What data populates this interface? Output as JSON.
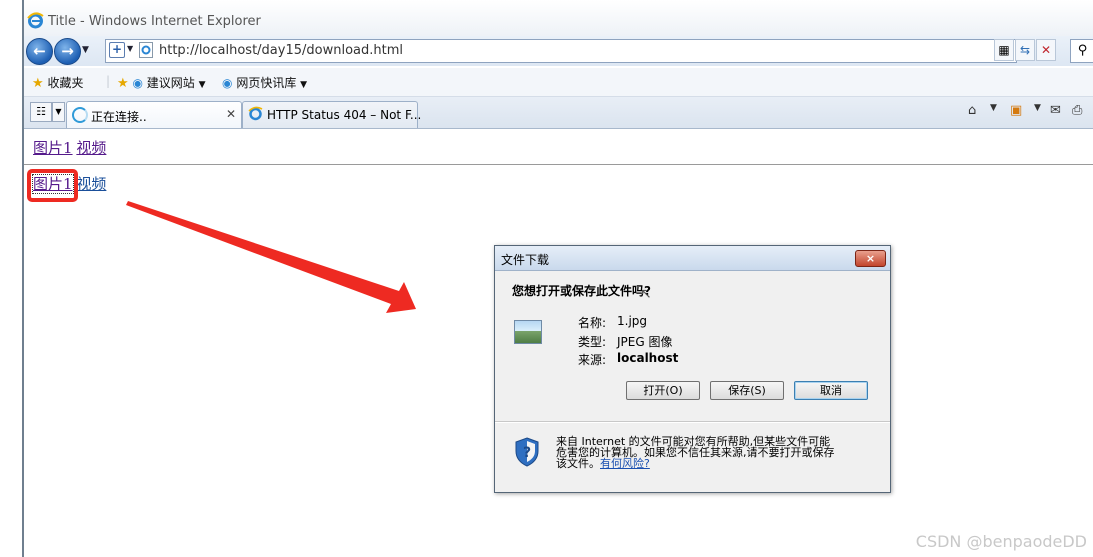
{
  "window": {
    "title": "Title - Windows Internet Explorer"
  },
  "nav": {
    "back_icon": "back-arrow-icon",
    "forward_icon": "forward-arrow-icon",
    "address": "http://localhost/day15/download.html",
    "search_icon": "magnifier-icon"
  },
  "favorites": {
    "label": "收藏夹",
    "items": [
      {
        "label": "建议网站"
      },
      {
        "label": "网页快讯库"
      }
    ]
  },
  "tabs": [
    {
      "label": "正在连接..",
      "state": "loading"
    },
    {
      "label": "HTTP Status 404 – Not F..."
    }
  ],
  "page": {
    "row1": {
      "link1": "图片1",
      "link2": "视频"
    },
    "row2": {
      "link1": "图片1",
      "link2": "视频"
    },
    "highlight_color": "#ee2a22",
    "arrow_color": "#ee2a22"
  },
  "dialog": {
    "title": "文件下载",
    "close_label": "×",
    "question": "您想打开或保存此文件吗?",
    "file_icon": "image-file-icon",
    "name_label": "名称:",
    "name_value": "1.jpg",
    "type_label": "类型:",
    "type_value": "JPEG 图像",
    "source_label": "来源:",
    "source_value": "localhost",
    "buttons": {
      "open": "打开(O)",
      "save": "保存(S)",
      "cancel": "取消"
    },
    "warning_line1": "来自 Internet 的文件可能对您有所帮助,但某些文件可能",
    "warning_line2": "危害您的计算机。如果您不信任其来源,请不要打开或保存",
    "warning_line3": "该文件。",
    "risk_link": "有何风险?",
    "shield_icon": "security-shield-icon"
  },
  "watermark": "CSDN @benpaodeDD"
}
